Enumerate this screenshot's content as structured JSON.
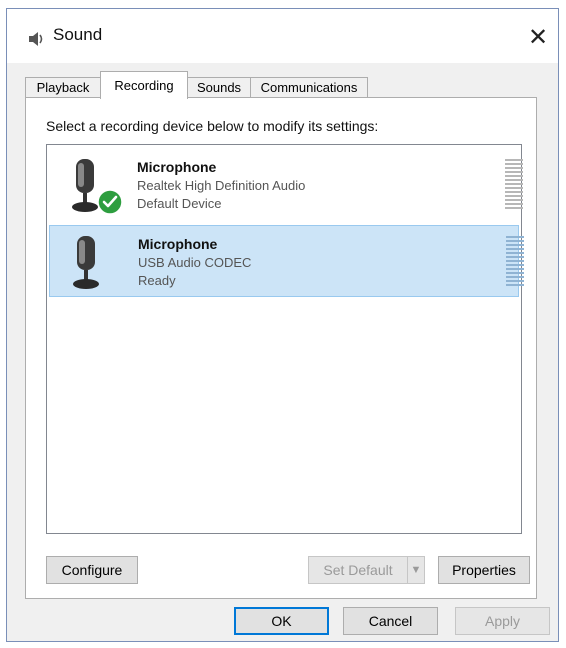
{
  "window": {
    "title": "Sound",
    "close_label": "✕"
  },
  "tabs": [
    {
      "label": "Playback",
      "active": false
    },
    {
      "label": "Recording",
      "active": true
    },
    {
      "label": "Sounds",
      "active": false
    },
    {
      "label": "Communications",
      "active": false
    }
  ],
  "panel": {
    "instruction": "Select a recording device below to modify its settings:"
  },
  "devices": [
    {
      "name": "Microphone",
      "description": "Realtek High Definition Audio",
      "status": "Default Device",
      "default": true,
      "selected": false
    },
    {
      "name": "Microphone",
      "description": "USB Audio CODEC",
      "status": "Ready",
      "default": false,
      "selected": true
    }
  ],
  "panel_buttons": {
    "configure": "Configure",
    "set_default": "Set Default",
    "set_default_arrow": "▼",
    "properties": "Properties"
  },
  "dialog_buttons": {
    "ok": "OK",
    "cancel": "Cancel",
    "apply": "Apply"
  },
  "colors": {
    "selection": "#cce4f7",
    "selection_border": "#99c9ef",
    "check_green": "#2e9e3f",
    "accent": "#0078d7"
  }
}
